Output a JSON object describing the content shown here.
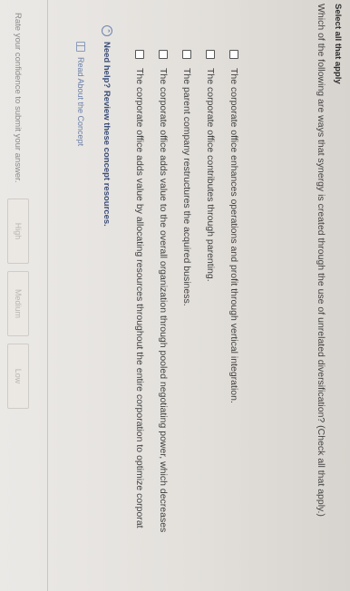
{
  "question": {
    "kicker": "Select all that apply",
    "text": "Which of the following are ways that synergy is created through the use of unrelated diversification? (Check all that apply.)"
  },
  "options": [
    {
      "label": "The corporate office enhances operations and profit through vertical integration.",
      "checked": false
    },
    {
      "label": "The corporate office contributes through parenting.",
      "checked": false
    },
    {
      "label": "The parent company restructures the acquired business.",
      "checked": false
    },
    {
      "label": "The corporate office adds value to the overall organization through pooled negotiating power, which decreases",
      "checked": false
    },
    {
      "label": "The corporate office adds value by allocating resources throughout the entire corporation to optimize corporat",
      "checked": false
    }
  ],
  "concept": {
    "help_text": "Need help? Review these concept resources.",
    "resource_link": "Read About the Concept"
  },
  "footer": {
    "rate_text": "Rate your confidence to submit your answer.",
    "buttons": [
      "High",
      "Medium",
      "Low"
    ]
  }
}
